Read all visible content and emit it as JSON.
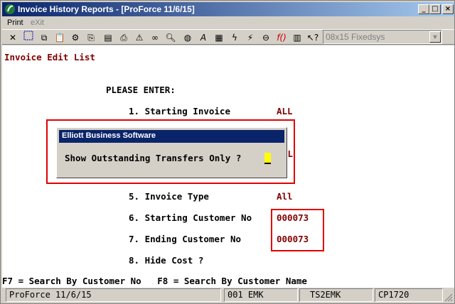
{
  "window": {
    "title": "Invoice History Reports - [ProForce 11/6/15]",
    "controls": {
      "minimize": "_",
      "maximize": "□",
      "close": "×"
    }
  },
  "menu": [
    {
      "label": "Print",
      "disabled": false
    },
    {
      "label": "eXit",
      "disabled": true
    }
  ],
  "toolbar": {
    "icons": [
      "close-icon",
      "select-icon",
      "copy-icon",
      "paste-icon",
      "settings-icon",
      "export-icon",
      "notes-icon",
      "printer-icon",
      "alert-icon",
      "binoculars-icon",
      "search-icon",
      "globe-icon",
      "font-icon",
      "calculator-icon",
      "lightning-icon",
      "report-icon",
      "link-icon",
      "function-icon",
      "book-icon",
      "help-icon"
    ],
    "font_select": "08x15 Fixedsys"
  },
  "screen": {
    "heading": "Invoice Edit List",
    "prompt": "PLEASE ENTER:",
    "fields": [
      {
        "label": "1. Starting Invoice",
        "value": "ALL"
      },
      {
        "label": "5. Invoice Type",
        "value": "All"
      },
      {
        "label": "6. Starting Customer No",
        "value": "000073"
      },
      {
        "label": "7. Ending Customer No",
        "value": "000073"
      },
      {
        "label": "8. Hide Cost ?",
        "value": ""
      }
    ],
    "partial_value_behind_dialog": "LL",
    "function_keys": "F7 = Search By Customer No   F8 = Search By Customer Name"
  },
  "dialog": {
    "title": "Elliott Business Software",
    "question": "Show Outstanding Transfers Only ?"
  },
  "status": {
    "session": "ProForce 11/6/15",
    "user": "001 EMK",
    "terminal": "TS2EMK",
    "code": "CP1720"
  },
  "colors": {
    "title_bar": "#0a246a",
    "field_value": "#800000",
    "highlight_box": "#e00000",
    "dialog_input": "#ffff00"
  }
}
